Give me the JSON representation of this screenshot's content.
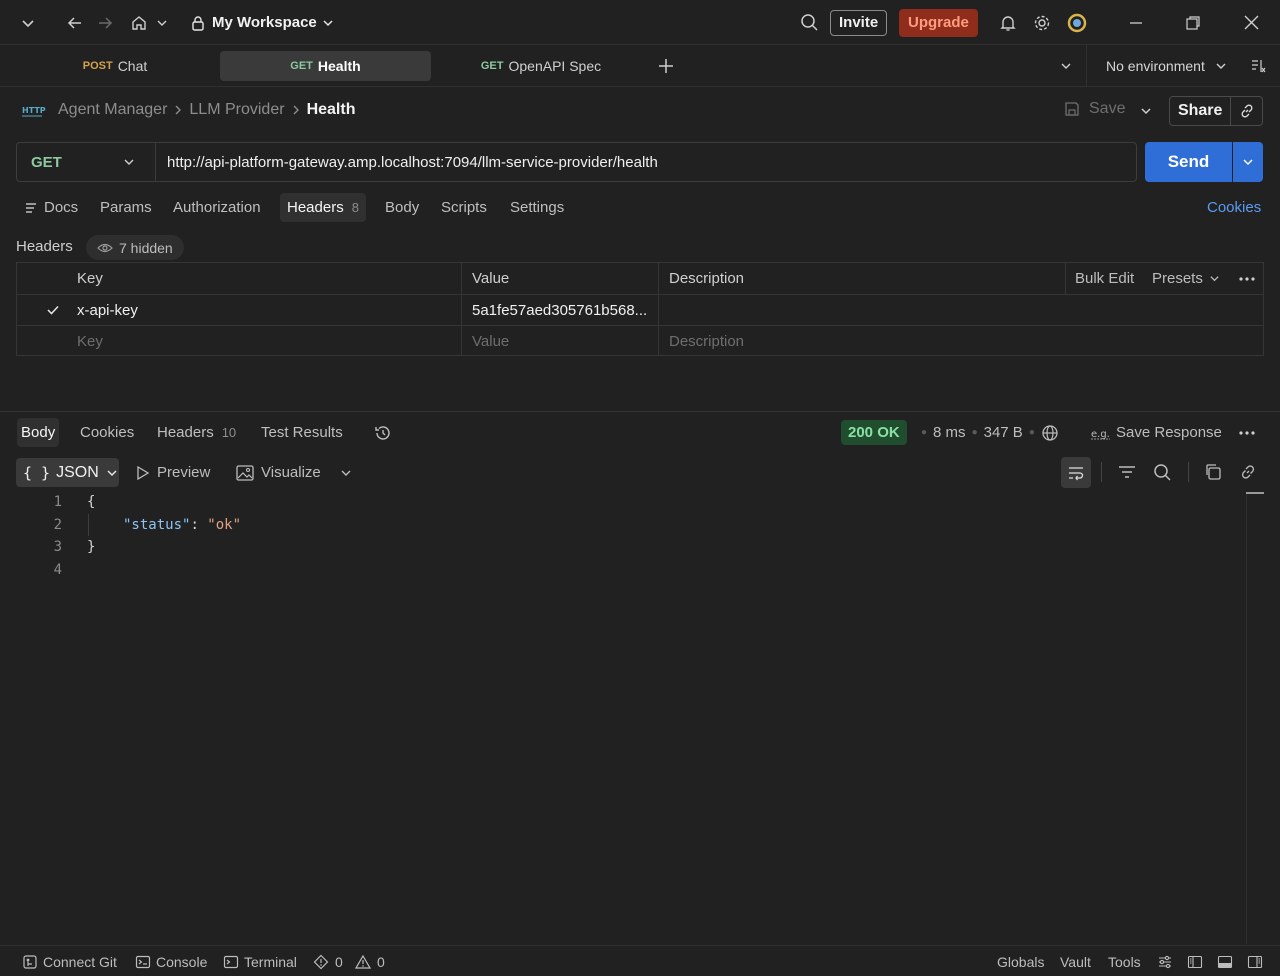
{
  "titlebar": {
    "workspace_name": "My Workspace",
    "invite_label": "Invite",
    "upgrade_label": "Upgrade"
  },
  "tabs": [
    {
      "method": "POST",
      "label": "Chat"
    },
    {
      "method": "GET",
      "label": "Health"
    },
    {
      "method": "GET",
      "label": "OpenAPI Spec"
    }
  ],
  "environment": {
    "selected": "No environment"
  },
  "breadcrumb": {
    "icon_text": "HTTP",
    "items": [
      "Agent Manager",
      "LLM Provider",
      "Health"
    ]
  },
  "request_actions": {
    "save_label": "Save",
    "share_label": "Share"
  },
  "request": {
    "method": "GET",
    "url": "http://api-platform-gateway.amp.localhost:7094/llm-service-provider/health",
    "send_label": "Send"
  },
  "request_tabs": [
    {
      "label": "Docs"
    },
    {
      "label": "Params"
    },
    {
      "label": "Authorization"
    },
    {
      "label": "Headers",
      "count": "8"
    },
    {
      "label": "Body"
    },
    {
      "label": "Scripts"
    },
    {
      "label": "Settings"
    }
  ],
  "cookies_link": "Cookies",
  "headers_section": {
    "title": "Headers",
    "hidden_label": "7 hidden",
    "columns": {
      "key": "Key",
      "value": "Value",
      "description": "Description"
    },
    "bulk_edit": "Bulk Edit",
    "presets": "Presets",
    "rows": [
      {
        "checked": true,
        "key": "x-api-key",
        "value": "5a1fe57aed305761b568...",
        "description": ""
      }
    ],
    "placeholders": {
      "key": "Key",
      "value": "Value",
      "description": "Description"
    }
  },
  "response": {
    "tabs": [
      {
        "label": "Body"
      },
      {
        "label": "Cookies"
      },
      {
        "label": "Headers",
        "count": "10"
      },
      {
        "label": "Test Results"
      }
    ],
    "status": "200 OK",
    "time": "8 ms",
    "size": "347 B",
    "save_response": "Save Response",
    "format": "JSON",
    "preview_label": "Preview",
    "visualize_label": "Visualize",
    "lines": [
      "1",
      "2",
      "3",
      "4"
    ],
    "code": {
      "open": "{",
      "key": "\"status\"",
      "colon": ": ",
      "value": "\"ok\"",
      "close": "}"
    }
  },
  "statusbar": {
    "connect_git": "Connect Git",
    "console": "Console",
    "terminal": "Terminal",
    "errors": "0",
    "warnings": "0",
    "globals": "Globals",
    "vault": "Vault",
    "tools": "Tools"
  },
  "colors": {
    "accent_send": "#2f6ed6",
    "get_method": "#8cc9a0",
    "post_method": "#d4a24c",
    "status_ok": "#8be0a4",
    "upgrade": "#8e2d1b"
  }
}
